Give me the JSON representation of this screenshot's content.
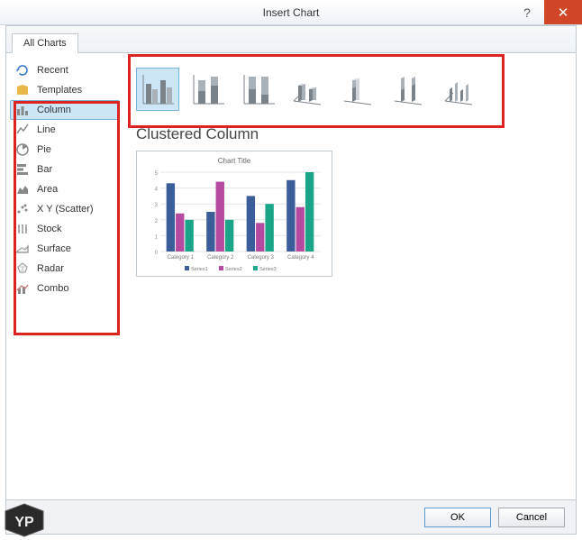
{
  "dialog": {
    "title": "Insert Chart",
    "help": "?",
    "close": "✕"
  },
  "tab": {
    "all_charts": "All Charts"
  },
  "sidebar": {
    "items": [
      {
        "label": "Recent",
        "icon": "recent-icon"
      },
      {
        "label": "Templates",
        "icon": "templates-icon"
      },
      {
        "label": "Column",
        "icon": "column-icon"
      },
      {
        "label": "Line",
        "icon": "line-icon"
      },
      {
        "label": "Pie",
        "icon": "pie-icon"
      },
      {
        "label": "Bar",
        "icon": "bar-icon"
      },
      {
        "label": "Area",
        "icon": "area-icon"
      },
      {
        "label": "X Y (Scatter)",
        "icon": "scatter-icon"
      },
      {
        "label": "Stock",
        "icon": "stock-icon"
      },
      {
        "label": "Surface",
        "icon": "surface-icon"
      },
      {
        "label": "Radar",
        "icon": "radar-icon"
      },
      {
        "label": "Combo",
        "icon": "combo-icon"
      }
    ],
    "selected_index": 2
  },
  "subtypes": {
    "selected_index": 0,
    "items": [
      "clustered-column",
      "stacked-column",
      "100-stacked-column",
      "3d-clustered-column",
      "3d-stacked-column",
      "3d-100-stacked-column",
      "3d-column"
    ]
  },
  "preview": {
    "heading": "Clustered Column",
    "chart_title": "Chart Title",
    "legend": [
      "Series1",
      "Series2",
      "Series3"
    ],
    "categories": [
      "Category 1",
      "Category 2",
      "Category 3",
      "Category 4"
    ]
  },
  "footer": {
    "ok": "OK",
    "cancel": "Cancel"
  },
  "chart_data": {
    "type": "bar",
    "title": "Chart Title",
    "categories": [
      "Category 1",
      "Category 2",
      "Category 3",
      "Category 4"
    ],
    "series": [
      {
        "name": "Series1",
        "color": "#3b5e9b",
        "values": [
          4.3,
          2.5,
          3.5,
          4.5
        ]
      },
      {
        "name": "Series2",
        "color": "#b54aa0",
        "values": [
          2.4,
          4.4,
          1.8,
          2.8
        ]
      },
      {
        "name": "Series3",
        "color": "#1aa589",
        "values": [
          2.0,
          2.0,
          3.0,
          5.0
        ]
      }
    ],
    "ylim": [
      0,
      5
    ],
    "xlabel": "",
    "ylabel": ""
  }
}
